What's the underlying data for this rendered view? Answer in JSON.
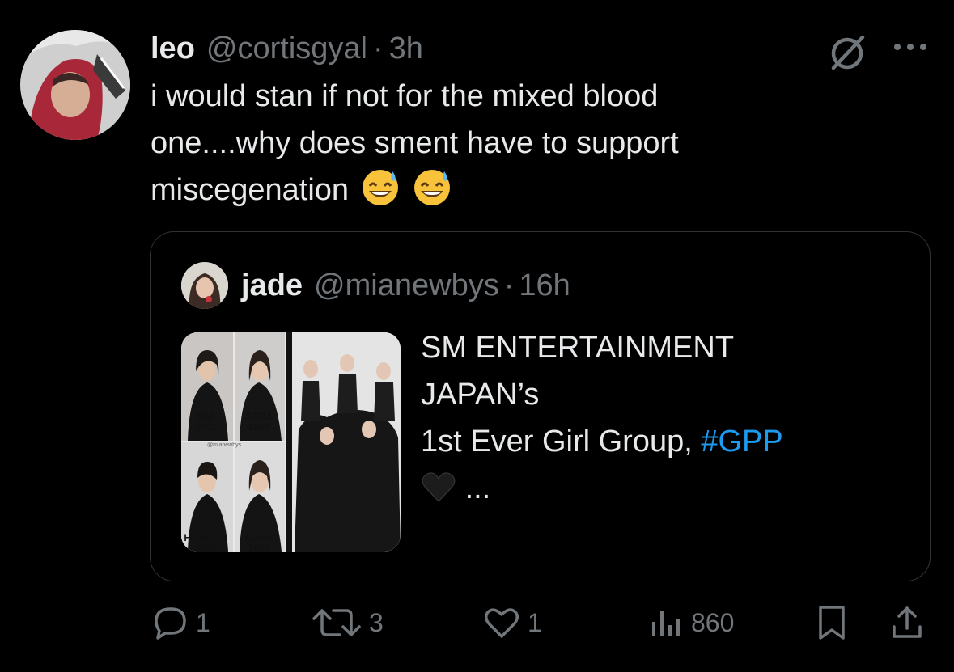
{
  "post": {
    "author_name": "leo",
    "author_handle": "@cortisgyal",
    "separator": "·",
    "time": "3h",
    "text_lines": [
      "i would stan if not for the mixed blood",
      "one....why does sment have to support",
      "miscegenation"
    ],
    "emojis": [
      "grinning-sweat-emoji",
      "grinning-sweat-emoji"
    ]
  },
  "quote": {
    "author_name": "jade",
    "author_handle": "@mianewbys",
    "separator": "·",
    "time": "16h",
    "text_lines": [
      "SM ENTERTAINMENT",
      "JAPAN’s",
      "1st Ever Girl Group,"
    ],
    "hashtag": "#GPP",
    "ellipsis": "...",
    "media": {
      "watermark": "@mianewbys",
      "members": [
        {
          "name": "MIA",
          "year": "2002"
        },
        {
          "name": "SARA",
          "year": "2003"
        },
        {
          "name": "HONOKA",
          "year": "2004"
        },
        {
          "name": "LUNA",
          "year": "2005"
        }
      ]
    }
  },
  "actions": {
    "reply_count": "1",
    "repost_count": "3",
    "like_count": "1",
    "view_count": "860"
  },
  "colors": {
    "background": "#000000",
    "text": "#e7e9ea",
    "muted": "#71767b",
    "link": "#1d9bf0",
    "border": "#2f3336"
  }
}
